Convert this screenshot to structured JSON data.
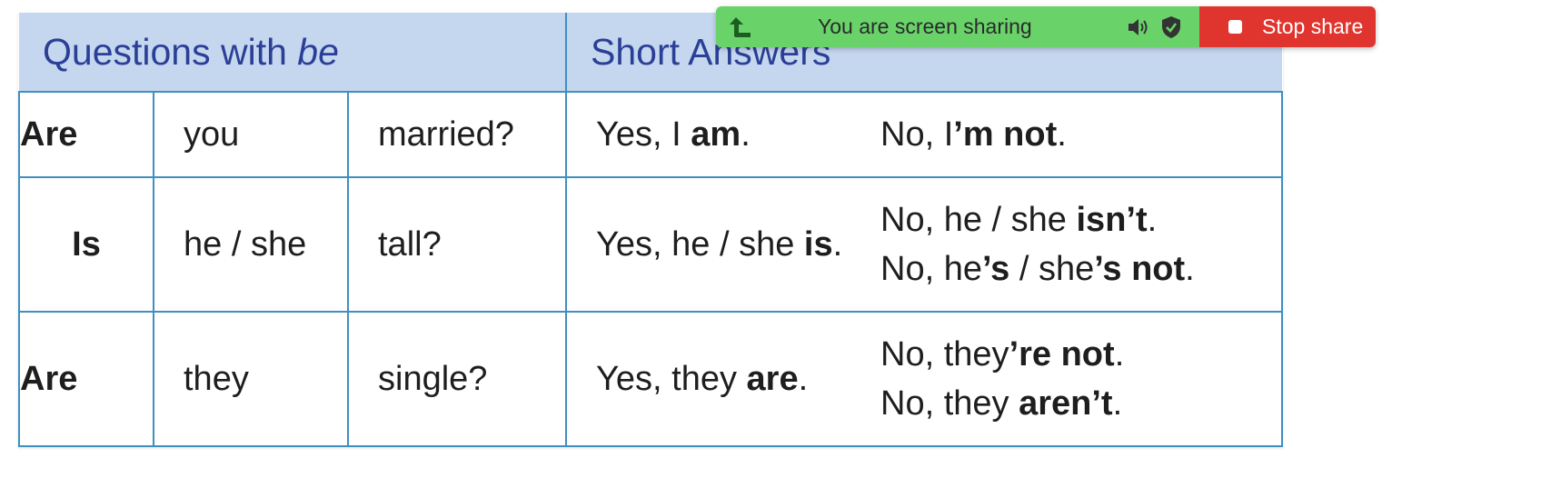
{
  "table": {
    "header": {
      "questions_label": "Questions with ",
      "questions_emph": "be",
      "answers_label": "Short Answers"
    },
    "rows": [
      {
        "verb": "Are",
        "subject": "you",
        "complement": "married?",
        "yes": {
          "pre": "Yes, I ",
          "bold": "am",
          "post": "."
        },
        "no": [
          {
            "pre": "No, I",
            "bold": "’m not",
            "mid": "",
            "bold2": "",
            "post": "."
          }
        ]
      },
      {
        "verb": "Is",
        "subject": "he / she",
        "complement": "tall?",
        "yes": {
          "pre": "Yes, he / she ",
          "bold": "is",
          "post": "."
        },
        "no": [
          {
            "pre": "No, he / she ",
            "bold": "isn’t",
            "mid": "",
            "bold2": "",
            "post": "."
          },
          {
            "pre": "No, he",
            "bold": "’s",
            "mid": " / she",
            "bold2": "’s not",
            "post": "."
          }
        ]
      },
      {
        "verb": "Are",
        "subject": "they",
        "complement": "single?",
        "yes": {
          "pre": "Yes, they ",
          "bold": "are",
          "post": "."
        },
        "no": [
          {
            "pre": "No, they",
            "bold": "’re not",
            "mid": "",
            "bold2": "",
            "post": "."
          },
          {
            "pre": "No, they ",
            "bold": "aren’t",
            "mid": "",
            "bold2": "",
            "post": "."
          }
        ]
      }
    ]
  },
  "share_bar": {
    "status_text": "You are screen sharing",
    "stop_label": "Stop share",
    "colors": {
      "bar": "#69d36a",
      "stop": "#e0352e"
    },
    "icons": [
      "arrow-icon",
      "speaker-icon",
      "shield-check-icon",
      "stop-square-icon"
    ]
  }
}
